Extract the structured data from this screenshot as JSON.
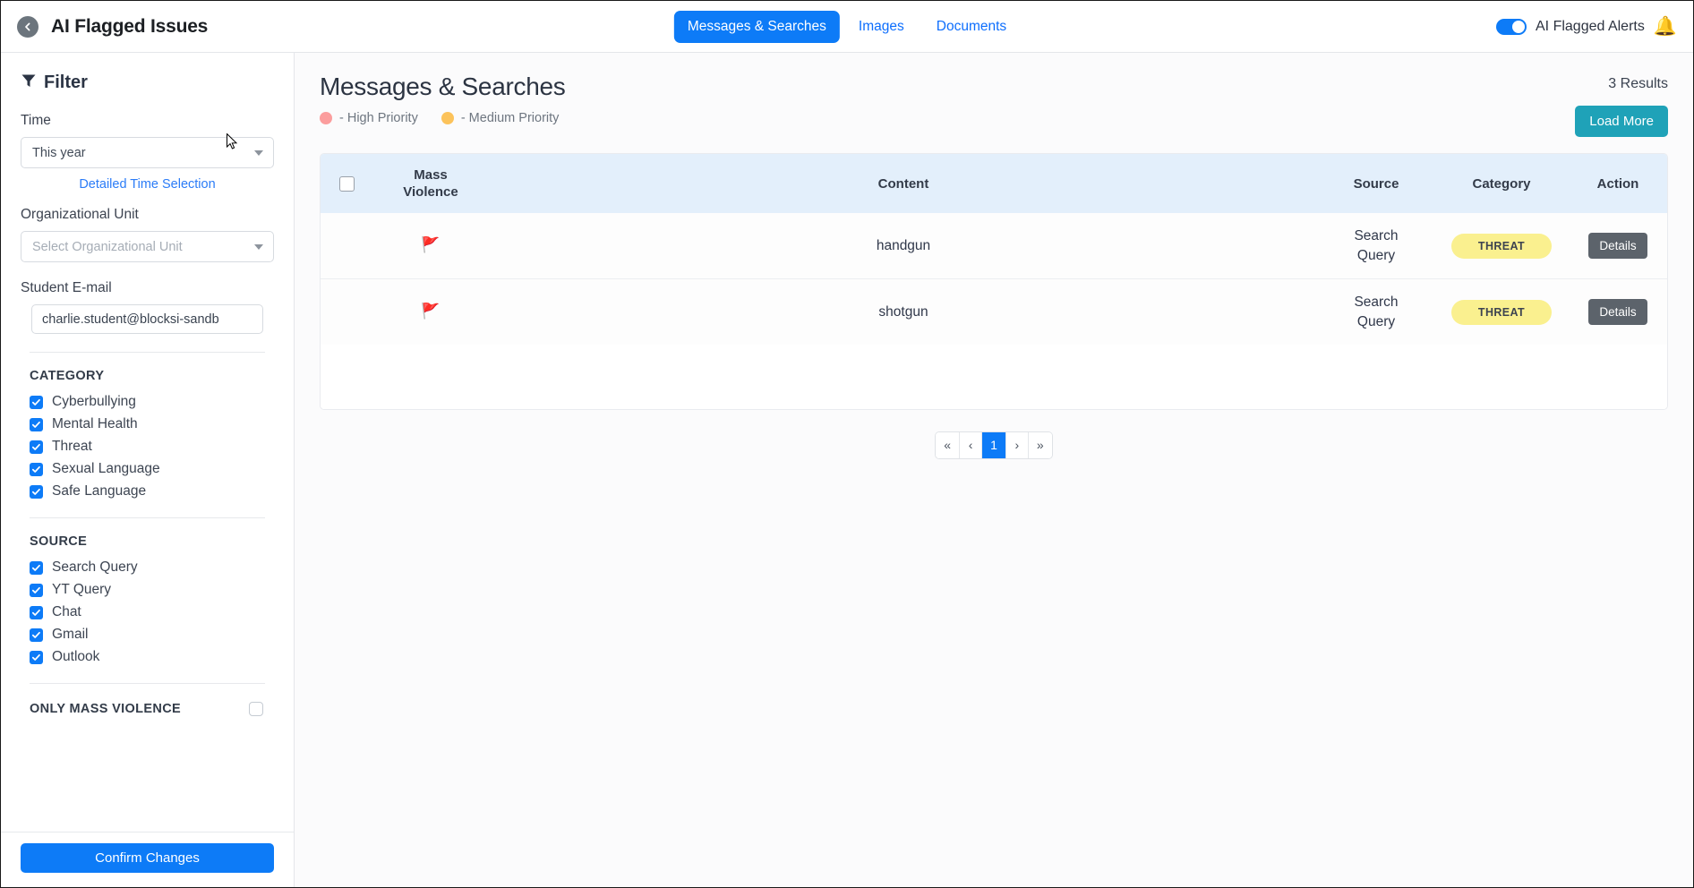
{
  "topbar": {
    "back_icon": "back-arrow-icon",
    "title": "AI Flagged Issues",
    "tabs": [
      {
        "label": "Messages & Searches",
        "active": true
      },
      {
        "label": "Images",
        "active": false
      },
      {
        "label": "Documents",
        "active": false
      }
    ],
    "toggle": {
      "label": "AI Flagged Alerts",
      "on": true
    },
    "bell_icon": "bell-icon"
  },
  "sidebar": {
    "filter_icon": "funnel-icon",
    "filter_title": "Filter",
    "time": {
      "label": "Time",
      "value": "This year",
      "detailed_link": "Detailed Time Selection"
    },
    "org_unit": {
      "label": "Organizational Unit",
      "placeholder": "Select Organizational Unit",
      "value": ""
    },
    "student_email": {
      "label": "Student E-mail",
      "value": "charlie.student@blocksi-sandb"
    },
    "category": {
      "title": "CATEGORY",
      "items": [
        {
          "label": "Cyberbullying",
          "checked": true
        },
        {
          "label": "Mental Health",
          "checked": true
        },
        {
          "label": "Threat",
          "checked": true
        },
        {
          "label": "Sexual Language",
          "checked": true
        },
        {
          "label": "Safe Language",
          "checked": true
        }
      ]
    },
    "source": {
      "title": "SOURCE",
      "items": [
        {
          "label": "Search Query",
          "checked": true
        },
        {
          "label": "YT Query",
          "checked": true
        },
        {
          "label": "Chat",
          "checked": true
        },
        {
          "label": "Gmail",
          "checked": true
        },
        {
          "label": "Outlook",
          "checked": true
        }
      ]
    },
    "only_mass_violence": {
      "label": "ONLY MASS VIOLENCE",
      "checked": false
    },
    "confirm_label": "Confirm Changes"
  },
  "main": {
    "page_title": "Messages & Searches",
    "results_count": "3 Results",
    "load_more_label": "Load More",
    "legend": [
      {
        "label": "- High Priority",
        "color": "#fb9d9d"
      },
      {
        "label": "- Medium Priority",
        "color": "#fcc35b"
      }
    ],
    "table": {
      "headers": {
        "mass_violence": "Mass Violence",
        "mass_violence_line1": "Mass",
        "mass_violence_line2": "Violence",
        "content": "Content",
        "source": "Source",
        "category": "Category",
        "action": "Action"
      },
      "rows": [
        {
          "flag": "🚩",
          "content": "handgun",
          "source_line1": "Search",
          "source_line2": "Query",
          "category": "THREAT",
          "action": "Details"
        },
        {
          "flag": "🚩",
          "content": "shotgun",
          "source_line1": "Search",
          "source_line2": "Query",
          "category": "THREAT",
          "action": "Details"
        }
      ]
    },
    "pagination": {
      "first": "«",
      "prev": "‹",
      "current": "1",
      "next": "›",
      "last": "»"
    }
  },
  "colors": {
    "primary_blue": "#0d7bf7",
    "teal": "#1fa2b8",
    "table_header_bg": "#e3effb",
    "pill_yellow": "#faf08f",
    "details_gray": "#5c636b",
    "flag_red": "#e02020"
  }
}
